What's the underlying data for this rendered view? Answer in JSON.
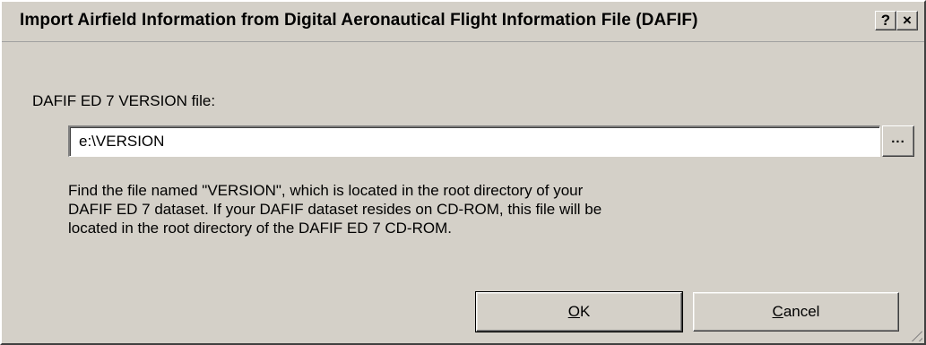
{
  "window": {
    "title": "Import Airfield Information from Digital Aeronautical Flight Information File (DAFIF)",
    "help_button": "?",
    "close_button": "×"
  },
  "form": {
    "file_label": "DAFIF ED 7 VERSION file:",
    "file_value": "e:\\VERSION",
    "browse_label": "..."
  },
  "help": {
    "lines": [
      "Find the file named \"VERSION\", which is located in the root directory of your",
      "DAFIF ED 7 dataset.  If your DAFIF dataset resides on CD-ROM, this file will be",
      "located in the root directory of the DAFIF ED 7 CD-ROM."
    ]
  },
  "buttons": {
    "ok": {
      "mnemonic": "O",
      "rest": "K"
    },
    "cancel": {
      "mnemonic": "C",
      "rest": "ancel"
    }
  }
}
